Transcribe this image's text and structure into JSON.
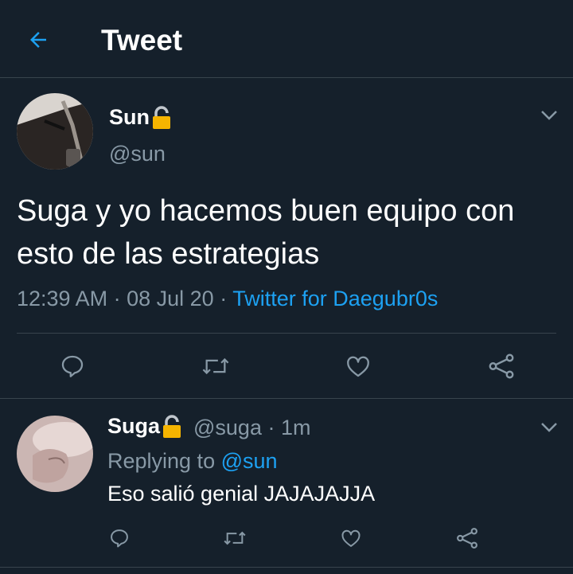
{
  "header": {
    "title": "Tweet"
  },
  "tweet": {
    "display_name": "Sun",
    "handle": "@sun",
    "text": "Suga y yo hacemos buen equipo con esto de las estrategias",
    "time": "12:39 AM",
    "date": "08 Jul 20",
    "separator": "·",
    "source": "Twitter for Daegubr0s"
  },
  "reply": {
    "display_name": "Suga",
    "handle": "@suga",
    "separator": "·",
    "age": "1m",
    "replying_label": "Replying to",
    "replying_to": "@sun",
    "text": "Eso salió genial JAJAJAJJA"
  },
  "icons": {
    "back": "arrow-left-icon",
    "lock": "lock-icon",
    "chevron": "chevron-down-icon",
    "reply": "comment-icon",
    "retweet": "retweet-icon",
    "like": "heart-icon",
    "share": "share-icon"
  },
  "colors": {
    "background": "#15202b",
    "accent": "#1da1f2",
    "muted": "#8899a6",
    "divider": "#38444d",
    "lock": "#f5b400"
  }
}
